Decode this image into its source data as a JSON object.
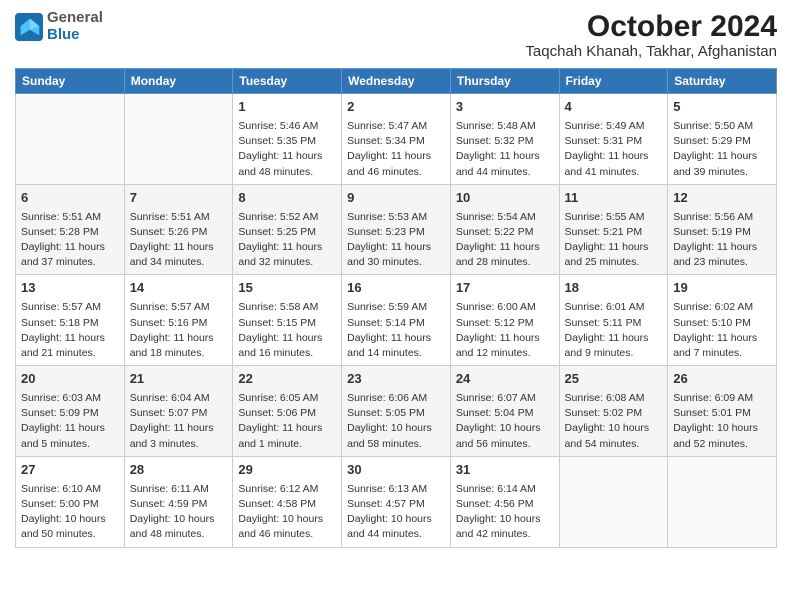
{
  "header": {
    "logo_line1": "General",
    "logo_line2": "Blue",
    "title": "October 2024",
    "subtitle": "Taqchah Khanah, Takhar, Afghanistan"
  },
  "days_of_week": [
    "Sunday",
    "Monday",
    "Tuesday",
    "Wednesday",
    "Thursday",
    "Friday",
    "Saturday"
  ],
  "weeks": [
    [
      {
        "day": "",
        "info": ""
      },
      {
        "day": "",
        "info": ""
      },
      {
        "day": "1",
        "info": "Sunrise: 5:46 AM\nSunset: 5:35 PM\nDaylight: 11 hours and 48 minutes."
      },
      {
        "day": "2",
        "info": "Sunrise: 5:47 AM\nSunset: 5:34 PM\nDaylight: 11 hours and 46 minutes."
      },
      {
        "day": "3",
        "info": "Sunrise: 5:48 AM\nSunset: 5:32 PM\nDaylight: 11 hours and 44 minutes."
      },
      {
        "day": "4",
        "info": "Sunrise: 5:49 AM\nSunset: 5:31 PM\nDaylight: 11 hours and 41 minutes."
      },
      {
        "day": "5",
        "info": "Sunrise: 5:50 AM\nSunset: 5:29 PM\nDaylight: 11 hours and 39 minutes."
      }
    ],
    [
      {
        "day": "6",
        "info": "Sunrise: 5:51 AM\nSunset: 5:28 PM\nDaylight: 11 hours and 37 minutes."
      },
      {
        "day": "7",
        "info": "Sunrise: 5:51 AM\nSunset: 5:26 PM\nDaylight: 11 hours and 34 minutes."
      },
      {
        "day": "8",
        "info": "Sunrise: 5:52 AM\nSunset: 5:25 PM\nDaylight: 11 hours and 32 minutes."
      },
      {
        "day": "9",
        "info": "Sunrise: 5:53 AM\nSunset: 5:23 PM\nDaylight: 11 hours and 30 minutes."
      },
      {
        "day": "10",
        "info": "Sunrise: 5:54 AM\nSunset: 5:22 PM\nDaylight: 11 hours and 28 minutes."
      },
      {
        "day": "11",
        "info": "Sunrise: 5:55 AM\nSunset: 5:21 PM\nDaylight: 11 hours and 25 minutes."
      },
      {
        "day": "12",
        "info": "Sunrise: 5:56 AM\nSunset: 5:19 PM\nDaylight: 11 hours and 23 minutes."
      }
    ],
    [
      {
        "day": "13",
        "info": "Sunrise: 5:57 AM\nSunset: 5:18 PM\nDaylight: 11 hours and 21 minutes."
      },
      {
        "day": "14",
        "info": "Sunrise: 5:57 AM\nSunset: 5:16 PM\nDaylight: 11 hours and 18 minutes."
      },
      {
        "day": "15",
        "info": "Sunrise: 5:58 AM\nSunset: 5:15 PM\nDaylight: 11 hours and 16 minutes."
      },
      {
        "day": "16",
        "info": "Sunrise: 5:59 AM\nSunset: 5:14 PM\nDaylight: 11 hours and 14 minutes."
      },
      {
        "day": "17",
        "info": "Sunrise: 6:00 AM\nSunset: 5:12 PM\nDaylight: 11 hours and 12 minutes."
      },
      {
        "day": "18",
        "info": "Sunrise: 6:01 AM\nSunset: 5:11 PM\nDaylight: 11 hours and 9 minutes."
      },
      {
        "day": "19",
        "info": "Sunrise: 6:02 AM\nSunset: 5:10 PM\nDaylight: 11 hours and 7 minutes."
      }
    ],
    [
      {
        "day": "20",
        "info": "Sunrise: 6:03 AM\nSunset: 5:09 PM\nDaylight: 11 hours and 5 minutes."
      },
      {
        "day": "21",
        "info": "Sunrise: 6:04 AM\nSunset: 5:07 PM\nDaylight: 11 hours and 3 minutes."
      },
      {
        "day": "22",
        "info": "Sunrise: 6:05 AM\nSunset: 5:06 PM\nDaylight: 11 hours and 1 minute."
      },
      {
        "day": "23",
        "info": "Sunrise: 6:06 AM\nSunset: 5:05 PM\nDaylight: 10 hours and 58 minutes."
      },
      {
        "day": "24",
        "info": "Sunrise: 6:07 AM\nSunset: 5:04 PM\nDaylight: 10 hours and 56 minutes."
      },
      {
        "day": "25",
        "info": "Sunrise: 6:08 AM\nSunset: 5:02 PM\nDaylight: 10 hours and 54 minutes."
      },
      {
        "day": "26",
        "info": "Sunrise: 6:09 AM\nSunset: 5:01 PM\nDaylight: 10 hours and 52 minutes."
      }
    ],
    [
      {
        "day": "27",
        "info": "Sunrise: 6:10 AM\nSunset: 5:00 PM\nDaylight: 10 hours and 50 minutes."
      },
      {
        "day": "28",
        "info": "Sunrise: 6:11 AM\nSunset: 4:59 PM\nDaylight: 10 hours and 48 minutes."
      },
      {
        "day": "29",
        "info": "Sunrise: 6:12 AM\nSunset: 4:58 PM\nDaylight: 10 hours and 46 minutes."
      },
      {
        "day": "30",
        "info": "Sunrise: 6:13 AM\nSunset: 4:57 PM\nDaylight: 10 hours and 44 minutes."
      },
      {
        "day": "31",
        "info": "Sunrise: 6:14 AM\nSunset: 4:56 PM\nDaylight: 10 hours and 42 minutes."
      },
      {
        "day": "",
        "info": ""
      },
      {
        "day": "",
        "info": ""
      }
    ]
  ]
}
